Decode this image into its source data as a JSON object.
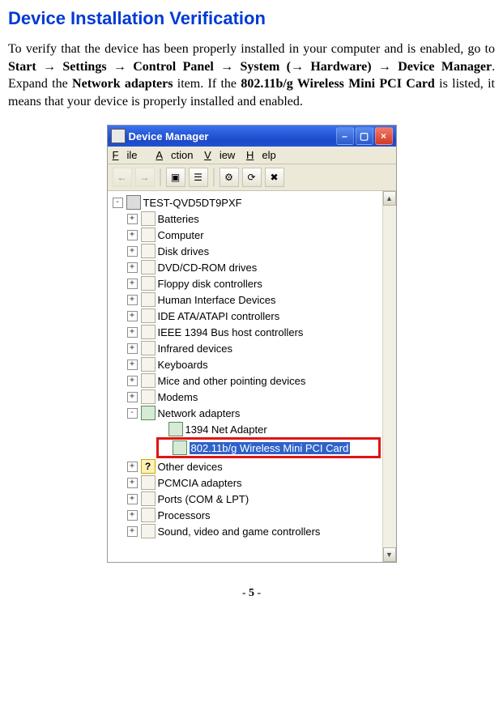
{
  "heading": "Device Installation Verification",
  "para_parts": {
    "t1": "To verify that the device has been properly installed in your computer and is enabled, go to ",
    "b1": "Start ",
    "a": "→",
    "b2": " Settings ",
    "b3": " Control Panel ",
    "b4": " System (",
    "b5": " Hardware) ",
    "b6": " Device Manager",
    "t2": ". Expand the ",
    "b7": "Network adapters",
    "t3": " item. If the ",
    "b8": "802.11b/g Wireless Mini PCI Card",
    "t4": " is listed, it means that your device is properly installed and enabled."
  },
  "window": {
    "title": "Device Manager",
    "menu": {
      "file": "File",
      "action": "Action",
      "view": "View",
      "help": "Help"
    }
  },
  "tree": {
    "root": "TEST-QVD5DT9PXF",
    "items": [
      "Batteries",
      "Computer",
      "Disk drives",
      "DVD/CD-ROM drives",
      "Floppy disk controllers",
      "Human Interface Devices",
      "IDE ATA/ATAPI controllers",
      "IEEE 1394 Bus host controllers",
      "Infrared devices",
      "Keyboards",
      "Mice and other pointing devices",
      "Modems"
    ],
    "network": {
      "label": "Network adapters",
      "children": {
        "c1": "1394 Net Adapter",
        "c2": "802.11b/g Wireless Mini PCI Card"
      }
    },
    "rest": [
      "Other devices",
      "PCMCIA adapters",
      "Ports (COM & LPT)",
      "Processors",
      "Sound, video and game controllers"
    ]
  },
  "page": {
    "prefix": "- ",
    "num": "5",
    "suffix": " -"
  }
}
